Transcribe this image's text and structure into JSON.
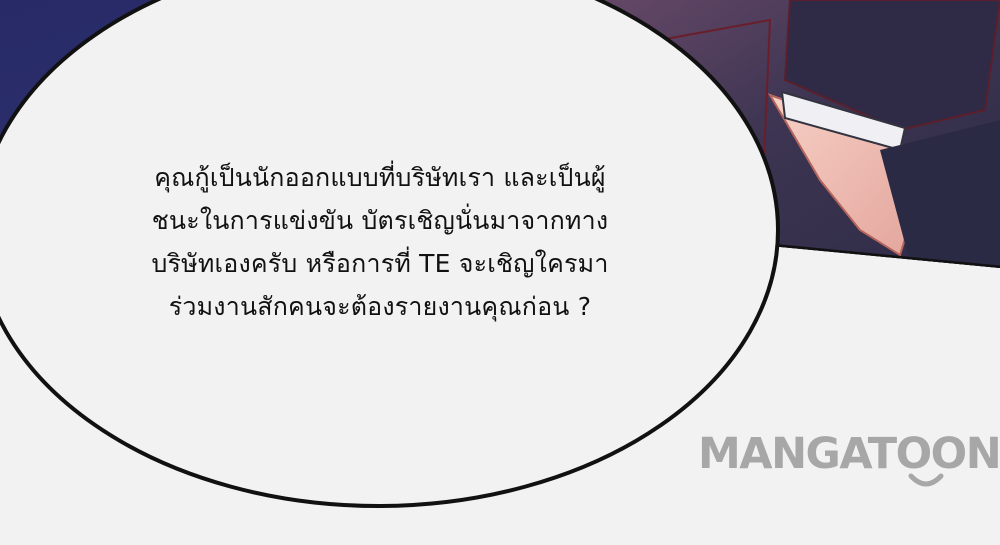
{
  "speech_bubble": {
    "lines": [
      "คุณกู้เป็นนักออกแบบที่บริษัทเรา และเป็นผู้",
      "ชนะในการแข่งขัน บัตรเชิญนั่นมาจากทาง",
      "บริษัทเองครับ หรือการที่ TE จะเชิญใครมา",
      "ร่วมงานสักคนจะต้องรายงานคุณก่อน ?"
    ]
  },
  "watermark": {
    "text": "MANGATOON",
    "icon": "smile-arc-icon"
  },
  "colors": {
    "bubble_fill": "#f2f2f2",
    "outline": "#111111",
    "night_sky": "#2a2f6a",
    "jacket": "#3a3350",
    "cuff": "#efeff4",
    "hand": "#f3c2bb",
    "watermark": "#a7a7a7"
  }
}
